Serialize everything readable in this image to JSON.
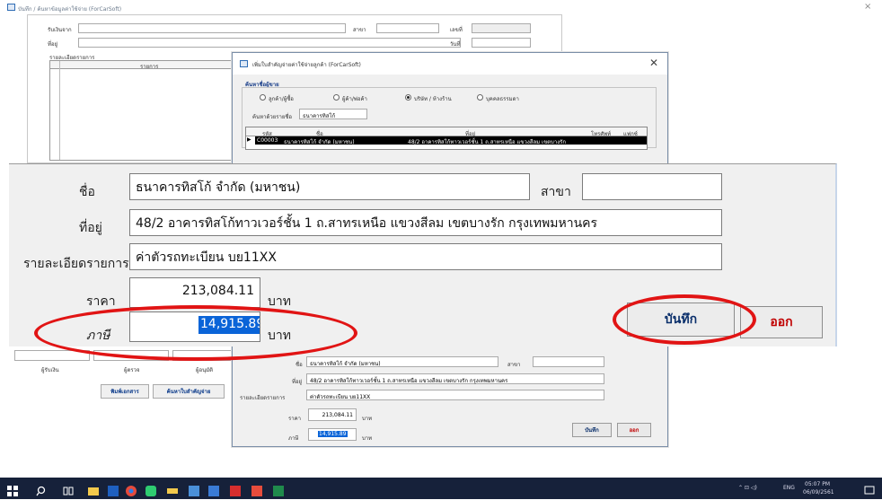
{
  "app": {
    "title": "บันทึก / ค้นหาข้อมูลค่าใช้จ่าย (ForCarSoft)",
    "close_glyph": "×"
  },
  "background_form": {
    "received_from_label": "รับเงินจาก",
    "address_label": "ที่อยู่",
    "branch_label": "สาขา",
    "number_label": "เลขที่",
    "date_label": "วันที่",
    "details_header": "รายละเอียดรายการ",
    "item_column": "รายการ",
    "bottom_labels": [
      "ผู้รับเงิน",
      "ผู้ตรวจ",
      "ผู้อนุมัติ"
    ],
    "print_button": "พิมพ์เอกสาร",
    "search_button": "ค้นหาใบสำคัญจ่าย"
  },
  "dialog": {
    "title": "เพิ่มใบสำคัญจ่ายค่าใช้จ่ายลูกค้า (ForCarSoft)",
    "close_glyph": "✕",
    "group_label": "ค้นหาชื่อผู้ขาย",
    "radio_options": [
      {
        "label": "ลูกค้า/ผู้ซื้อ",
        "checked": false
      },
      {
        "label": "ผู้ค้า/พ่อค้า",
        "checked": false
      },
      {
        "label": "บริษัท / ห้างร้าน",
        "checked": true
      },
      {
        "label": "บุคคลธรรมดา",
        "checked": false
      }
    ],
    "search_label": "ค้นหาด้วยรายชื่อ",
    "search_value": "ธนาคารทิสโก้",
    "grid_headers": [
      "รหัส",
      "ชื่อ",
      "ที่อยู่",
      "โทรศัพท์",
      "แฟกซ์"
    ],
    "grid_row": {
      "marker": "▶",
      "code": "C00003",
      "name": "ธนาคารทิสโก้ จำกัด (มหาชน)",
      "address": "48/2 อาคารทิสโก้ทาวเวอร์ชั้น 1 ถ.สาทรเหนือ แขวงสีลม เขตบางรัก"
    }
  },
  "form": {
    "name_label": "ชื่อ",
    "name_value": "ธนาคารทิสโก้ จำกัด (มหาชน)",
    "branch_label": "สาขา",
    "branch_value": "",
    "address_label": "ที่อยู่",
    "address_value": "48/2 อาคารทิสโก้ทาวเวอร์ชั้น 1 ถ.สาทรเหนือ แขวงสีลม เขตบางรัก กรุงเทพมหานคร",
    "details_label": "รายละเอียดรายการ",
    "details_value": "ค่าตัวรถทะเบียน บย11XX",
    "price_label": "ราคา",
    "price_value": "213,084.11",
    "tax_label": "ภาษี",
    "tax_value": "14,915.89",
    "currency_unit": "บาท",
    "save_button": "บันทึก",
    "exit_button": "ออก"
  },
  "taskbar": {
    "clock_time": "05:07 PM",
    "clock_date": "06/09/2561",
    "lang": "ENG"
  },
  "colors": {
    "highlight_oval": "#e11414",
    "selection": "#0a64d8",
    "exit_text": "#c00000",
    "save_text": "#0a2f6b",
    "taskbar": "#16213a"
  }
}
